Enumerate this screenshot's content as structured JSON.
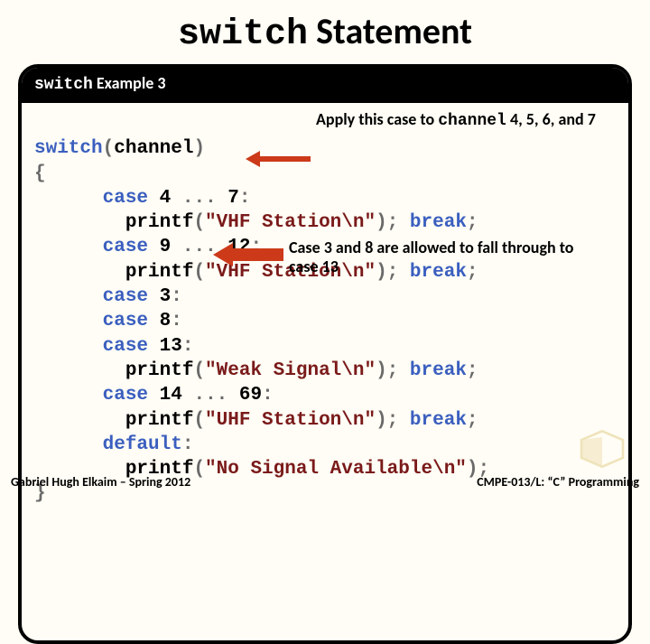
{
  "title": {
    "mono": "switch",
    "rest": " Statement"
  },
  "panel_header": {
    "mono": "switch",
    "rest": " Example 3"
  },
  "code": {
    "l0_a": "switch",
    "l0_b": "(",
    "l0_c": "channel",
    "l0_d": ")",
    "l1": "{",
    "l2_a": "      case",
    "l2_b": " 4 ",
    "l2_c": ".",
    "l2_d": ".",
    "l2_e": ".",
    "l2_f": " 7",
    "l2_g": ":",
    "l3_a": "        printf",
    "l3_b": "(",
    "l3_c": "\"VHF Station\\n\"",
    "l3_d": ");",
    "l3_sp": " ",
    "l3_e": "break",
    "l3_f": ";",
    "l4_a": "      case",
    "l4_b": " 9 ",
    "l4_c": ".",
    "l4_d": ".",
    "l4_e": ".",
    "l4_f": " 12",
    "l4_g": ":",
    "l5_a": "        printf",
    "l5_b": "(",
    "l5_c": "\"VHF Station\\n\"",
    "l5_d": ");",
    "l5_sp": " ",
    "l5_e": "break",
    "l5_f": ";",
    "l6_a": "      case",
    "l6_b": " 3",
    "l6_c": ":",
    "l7_a": "      case",
    "l7_b": " 8",
    "l7_c": ":",
    "l8_a": "      case",
    "l8_b": " 13",
    "l8_c": ":",
    "l9_a": "        printf",
    "l9_b": "(",
    "l9_c": "\"Weak Signal\\n\"",
    "l9_d": ");",
    "l9_sp": " ",
    "l9_e": "break",
    "l9_f": ";",
    "l10_a": "      case",
    "l10_b": " 14 ",
    "l10_c": ".",
    "l10_d": ".",
    "l10_e": ".",
    "l10_f": " 69",
    "l10_g": ":",
    "l11_a": "        printf",
    "l11_b": "(",
    "l11_c": "\"UHF Station\\n\"",
    "l11_d": ");",
    "l11_sp": " ",
    "l11_e": "break",
    "l11_f": ";",
    "l12_a": "      default",
    "l12_b": ":",
    "l13_a": "        printf",
    "l13_b": "(",
    "l13_c": "\"No Signal Available\\n\"",
    "l13_d": ");",
    "l14": "}"
  },
  "annotations": {
    "a1_pre": "Apply this case to ",
    "a1_mono": "channel",
    "a1_post": " 4, 5, 6, and 7",
    "a2": "Case 3 and 8 are allowed to fall through to case 13"
  },
  "footer": {
    "left": "Gabriel Hugh Elkaim – Spring 2012",
    "right": "CMPE-013/L: “C” Programming"
  }
}
